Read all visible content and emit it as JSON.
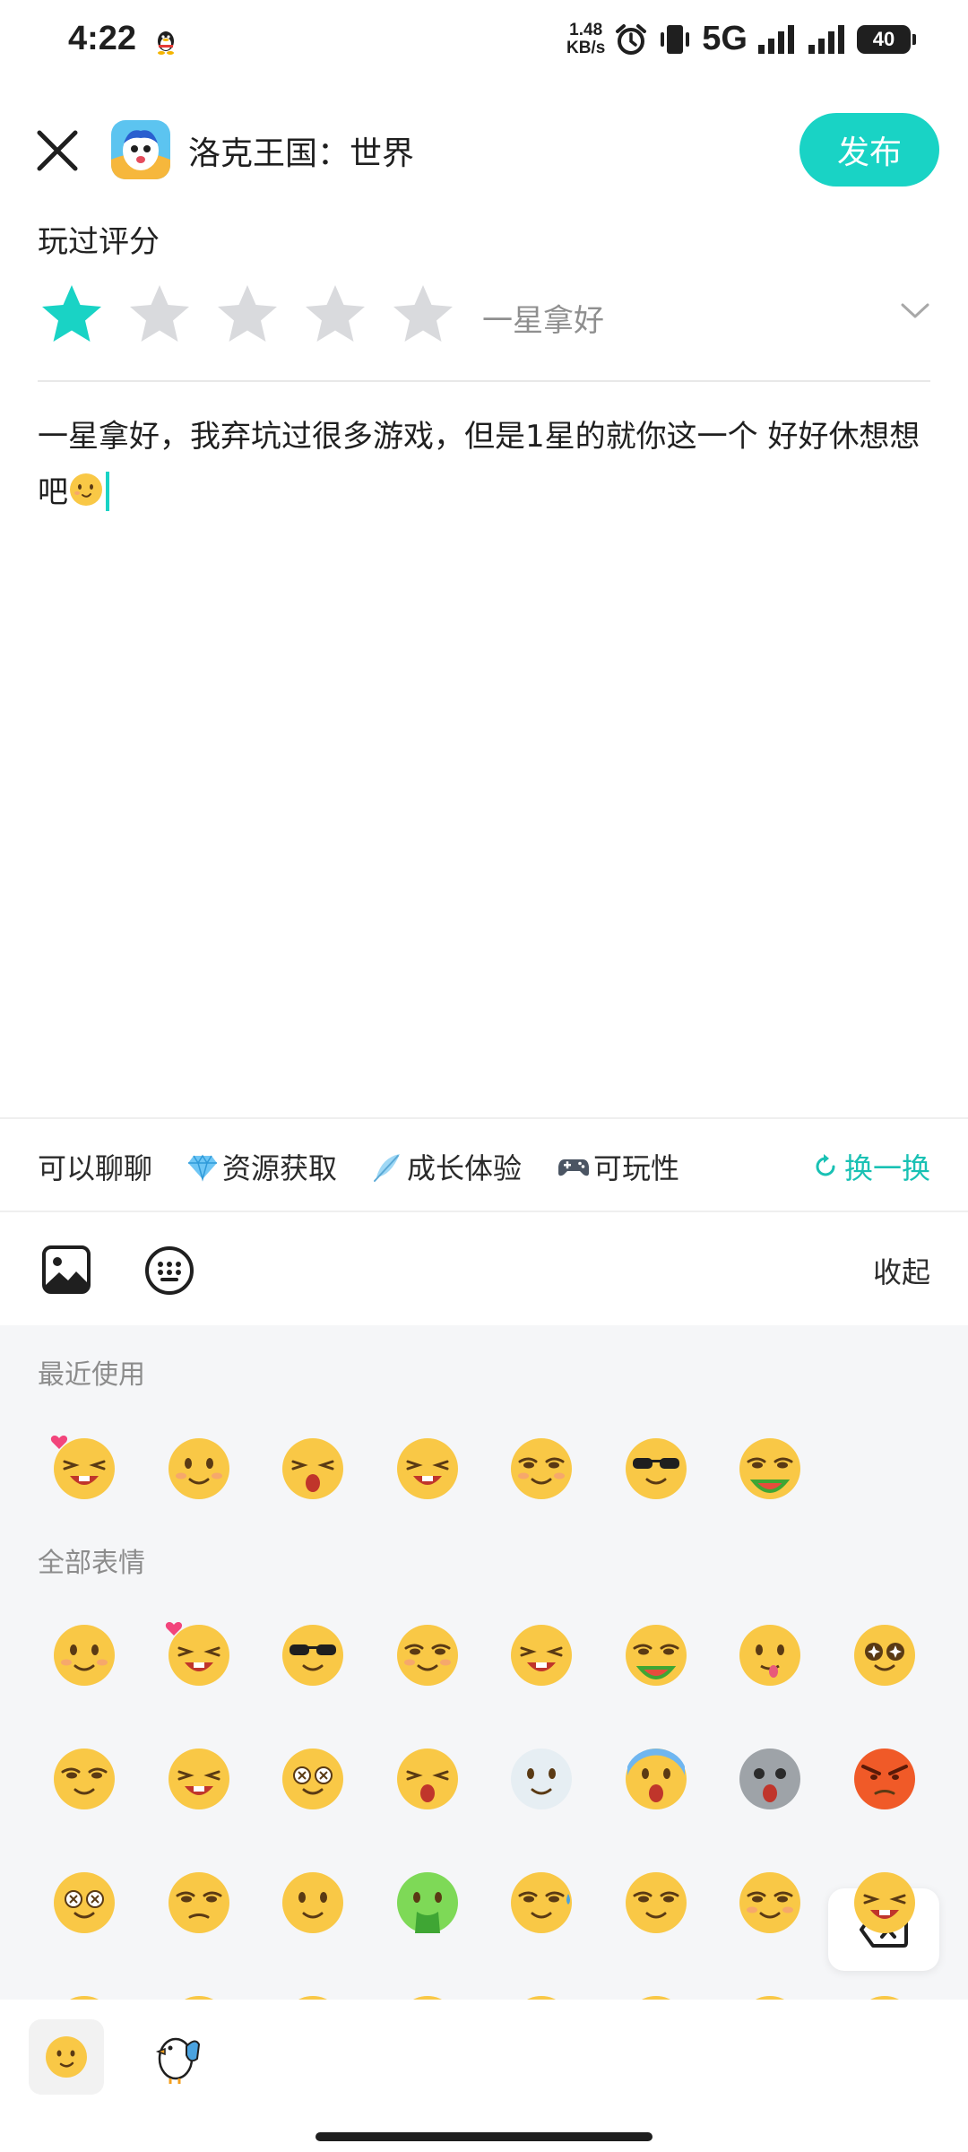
{
  "status_bar": {
    "time": "4:22",
    "net_speed_value": "1.48",
    "net_speed_unit": "KB/s",
    "network": "5G",
    "battery": "40"
  },
  "header": {
    "game_title": "洛克王国：世界",
    "publish_label": "发布"
  },
  "rating": {
    "label": "玩过评分",
    "value": 1,
    "max": 5,
    "value_text": "一星拿好",
    "active_color": "#19d3c5",
    "inactive_color": "#d9dadd"
  },
  "review": {
    "text": "一星拿好，我弃坑过很多游戏，但是1星的就你这一个 好好休想想吧"
  },
  "tags": {
    "items": [
      {
        "label": "可以聊聊",
        "icon": "none"
      },
      {
        "label": "资源获取",
        "icon": "diamond-icon"
      },
      {
        "label": "成长体验",
        "icon": "feather-icon"
      },
      {
        "label": "可玩性",
        "icon": "gamepad-icon"
      }
    ],
    "refresh_label": "换一换"
  },
  "toolbar": {
    "collapse_label": "收起"
  },
  "emoji_panel": {
    "recent_label": "最近使用",
    "all_label": "全部表情",
    "recent": [
      "heart-grin-emoji",
      "shy-smile-emoji",
      "screaming-emoji",
      "big-grin-emoji",
      "smug-smile-emoji",
      "sunglasses-emoji",
      "eating-watermelon-emoji"
    ],
    "all": [
      "shy-smile-emoji",
      "heart-grin-emoji",
      "sunglasses-emoji",
      "smug-smile-emoji",
      "big-grin-emoji",
      "eating-watermelon-emoji",
      "silly-tongue-emoji",
      "starry-eyes-emoji",
      "drooling-emoji",
      "laughing-emoji",
      "dizzy-glasses-emoji",
      "screaming-emoji",
      "crying-seal-emoji",
      "scared-emoji",
      "shocked-gray-emoji",
      "angry-emoji",
      "brain-explode-emoji",
      "unamused-emoji",
      "wink-sparkle-emoji",
      "vomiting-emoji",
      "sweat-emoji",
      "peeking-wall-emoji",
      "smirk-emoji",
      "grin-emoji",
      "thinking-emoji",
      "neutral-emoji",
      "confused-emoji",
      "calm-emoji",
      "sleepy-emoji",
      "relaxed-emoji",
      "cat-emoji",
      "pouting-emoji"
    ]
  },
  "bottom_tabs": {
    "items": [
      "emoji-tab",
      "sticker-tab"
    ]
  }
}
